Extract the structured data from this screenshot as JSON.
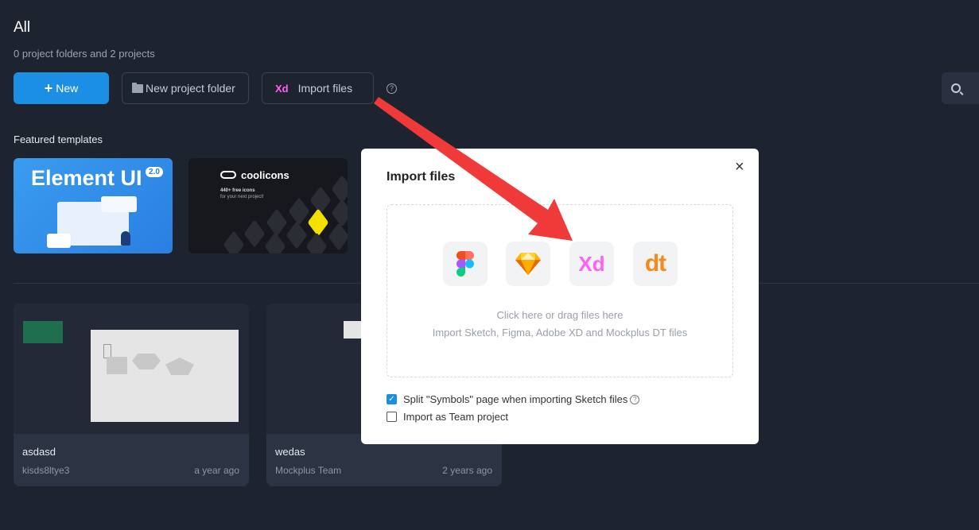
{
  "header": {
    "title": "All",
    "subtitle": "0 project folders and 2 projects"
  },
  "toolbar": {
    "new_label": "New",
    "new_project_folder_label": "New project folder",
    "import_icon_text": "Xd",
    "import_files_label": "Import files",
    "help_glyph": "?"
  },
  "featured": {
    "label": "Featured templates",
    "templates": [
      {
        "title": "Element UI",
        "badge": "2.0"
      },
      {
        "title": "coolicons",
        "line1": "440+ free icons",
        "line2": "for your next project!"
      }
    ]
  },
  "projects": [
    {
      "name": "asdasd",
      "owner": "kisds8ltye3",
      "time": "a year ago"
    },
    {
      "name": "wedas",
      "owner": "Mockplus Team",
      "time": "2 years ago"
    }
  ],
  "modal": {
    "title": "Import files",
    "close_glyph": "×",
    "icons": [
      "figma-icon",
      "sketch-icon",
      "xd-icon",
      "dt-icon"
    ],
    "xd_text": "Xd",
    "dt_text": "dt",
    "drop_line1": "Click here or drag files here",
    "drop_line2": "Import Sketch, Figma, Adobe XD and Mockplus DT files",
    "option_split_label": "Split \"Symbols\" page when importing Sketch files",
    "option_split_checked": true,
    "option_team_label": "Import as Team project",
    "option_team_checked": false,
    "check_glyph": "✓"
  },
  "colors": {
    "background": "#1e2330",
    "primary": "#1a8fe3",
    "xd": "#ff61f6",
    "dt": "#f28a1e",
    "arrow": "#f03a3a"
  }
}
